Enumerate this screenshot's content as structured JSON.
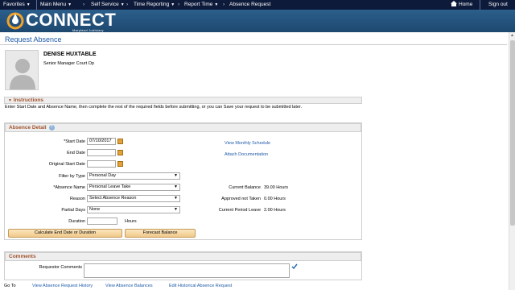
{
  "topnav": {
    "favorites": "Favorites",
    "main_menu": "Main Menu",
    "breadcrumb": [
      "Self Service",
      "Time Reporting",
      "Report Time",
      "Absence Request"
    ],
    "home": "Home",
    "signout": "Sign out"
  },
  "brand": {
    "name": "CONNECT",
    "subtitle": "Maryland Judiciary"
  },
  "page": {
    "title": "Request Absence"
  },
  "employee": {
    "name": "DENISE HUXTABLE",
    "title": "Senior Manager Court Op"
  },
  "instructions": {
    "header": "Instructions",
    "text": "Enter Start Date and Absence Name, then complete the rest of the required fields before submitting, or you can Save your request to be submitted later."
  },
  "absence_detail": {
    "header": "Absence Detail",
    "start_date_label": "*Start Date",
    "start_date": "07/10/2017",
    "end_date_label": "End Date",
    "original_start_label": "Original Start Date",
    "filter_label": "Filter by Type",
    "filter_value": "Personal Day",
    "absence_name_label": "*Absence Name",
    "absence_name_value": "Personal Leave Take",
    "reason_label": "Reason",
    "reason_value": "Select Absence Reason",
    "partial_label": "Partial Days",
    "partial_value": "None",
    "duration_label": "Duration",
    "duration_unit": "Hours",
    "calc_button": "Calculate End Date or Duration",
    "forecast_button": "Forecast Balance",
    "view_schedule": "View Monthly Schedule",
    "attach_doc": "Attach Documentation",
    "current_balance_label": "Current Balance",
    "current_balance": "39.00 Hours",
    "approved_not_taken_label": "Approved not Taken",
    "approved_not_taken": "0.00 Hours",
    "current_period_label": "Current Period Leave",
    "current_period": "2.00 Hours"
  },
  "comments": {
    "header": "Comments",
    "requestor_label": "Requestor Comments"
  },
  "footer": {
    "goto": "Go To",
    "links": [
      "View Absence Request History",
      "View Absence Balances",
      "Edit Historical Absence Request"
    ]
  },
  "colors": {
    "nav": "#0d1a3a",
    "banner": "#2c5f8c",
    "link": "#1e5aa8",
    "section_title": "#a0522d"
  }
}
